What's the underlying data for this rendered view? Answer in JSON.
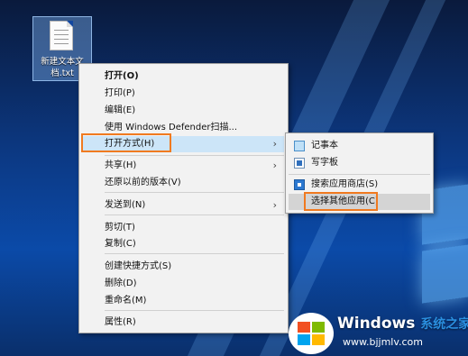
{
  "desktop": {
    "file": {
      "name": "新建文本文档.txt"
    }
  },
  "context_menu": {
    "items": [
      {
        "label": "打开(O)",
        "bold": true
      },
      {
        "label": "打印(P)"
      },
      {
        "label": "编辑(E)"
      },
      {
        "label": "使用 Windows Defender扫描..."
      },
      {
        "label": "打开方式(H)",
        "submenu": true,
        "highlighted": true
      },
      {
        "label": "共享(H)",
        "submenu": true
      },
      {
        "label": "还原以前的版本(V)"
      },
      {
        "label": "发送到(N)",
        "submenu": true
      },
      {
        "label": "剪切(T)"
      },
      {
        "label": "复制(C)"
      },
      {
        "label": "创建快捷方式(S)"
      },
      {
        "label": "删除(D)"
      },
      {
        "label": "重命名(M)"
      },
      {
        "label": "属性(R)"
      }
    ],
    "submenu_arrow": "›"
  },
  "open_with_submenu": {
    "items": [
      {
        "label": "记事本",
        "icon": "notepad-icon"
      },
      {
        "label": "写字板",
        "icon": "wordpad-icon"
      },
      {
        "label": "搜索应用商店(S)",
        "icon": "store-icon"
      },
      {
        "label": "选择其他应用(C)",
        "highlighted": true
      }
    ]
  },
  "watermark": {
    "brand": "Windows",
    "brand_cn": "系统之家",
    "url": "www.bjjmlv.com"
  },
  "colors": {
    "highlight_outline": "#f07a20",
    "menu_bg": "#f2f2f2",
    "hover_bg": "#cce5f8"
  }
}
